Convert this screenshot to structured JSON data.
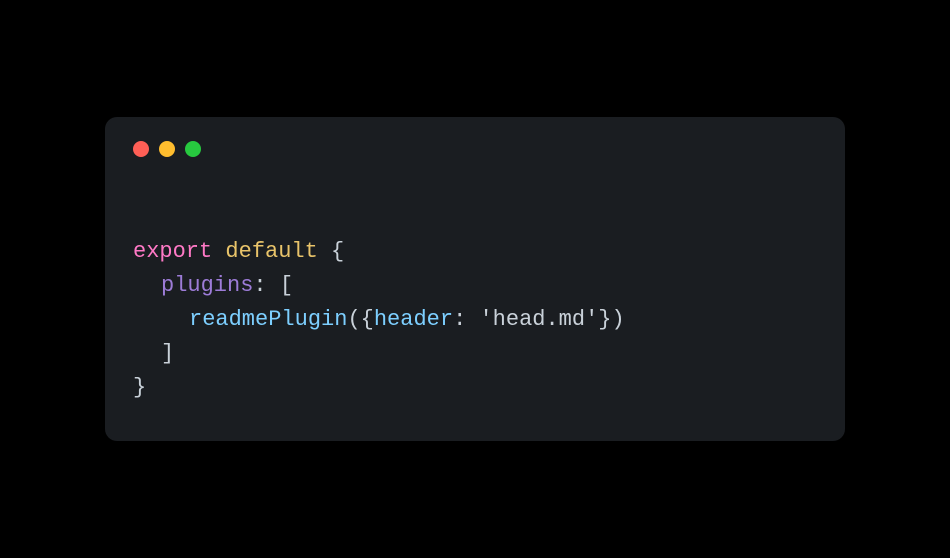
{
  "trafficLights": {
    "red": "close",
    "yellow": "minimize",
    "green": "maximize"
  },
  "code": {
    "line1": {
      "keyword": "export",
      "default": "default",
      "brace": "{"
    },
    "line2": {
      "prop": "plugins",
      "colon": ": ",
      "bracket": "["
    },
    "line3": {
      "func": "readmePlugin",
      "openParen": "(",
      "openBrace": "{",
      "param": "header",
      "colon": ": ",
      "string": "'head.md'",
      "closeBrace": "}",
      "closeParen": ")"
    },
    "line4": {
      "bracket": "]"
    },
    "line5": {
      "brace": "}"
    }
  }
}
